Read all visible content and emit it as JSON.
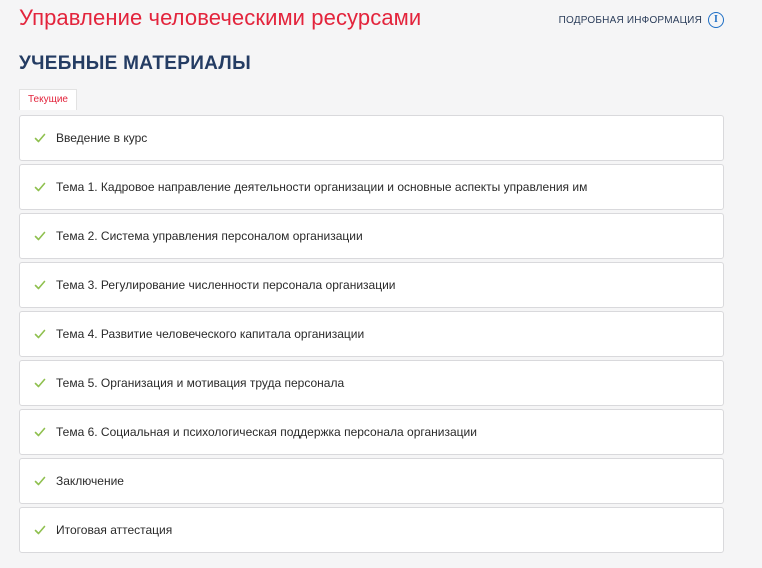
{
  "header": {
    "course_title": "Управление человеческими ресурсами",
    "details_label": "ПОДРОБНАЯ ИНФОРМАЦИЯ",
    "info_icon": "info-icon"
  },
  "materials": {
    "section_title": "УЧЕБНЫЕ МАТЕРИАЛЫ",
    "tab_label": "Текущие",
    "check_icon": "check-icon",
    "check_color": "#8fc04f",
    "accent_color": "#e3243c",
    "items": [
      {
        "label": "Введение в курс"
      },
      {
        "label": "Тема 1. Кадровое направление деятельности организации и основные аспекты управления им"
      },
      {
        "label": "Тема 2. Система управления персоналом организации"
      },
      {
        "label": "Тема 3. Регулирование численности персонала организации"
      },
      {
        "label": "Тема 4. Развитие человеческого капитала организации"
      },
      {
        "label": "Тема 5. Организация и мотивация труда персонала"
      },
      {
        "label": "Тема 6. Социальная и психологическая поддержка персонала организации"
      },
      {
        "label": "Заключение"
      },
      {
        "label": "Итоговая аттестация"
      }
    ]
  }
}
